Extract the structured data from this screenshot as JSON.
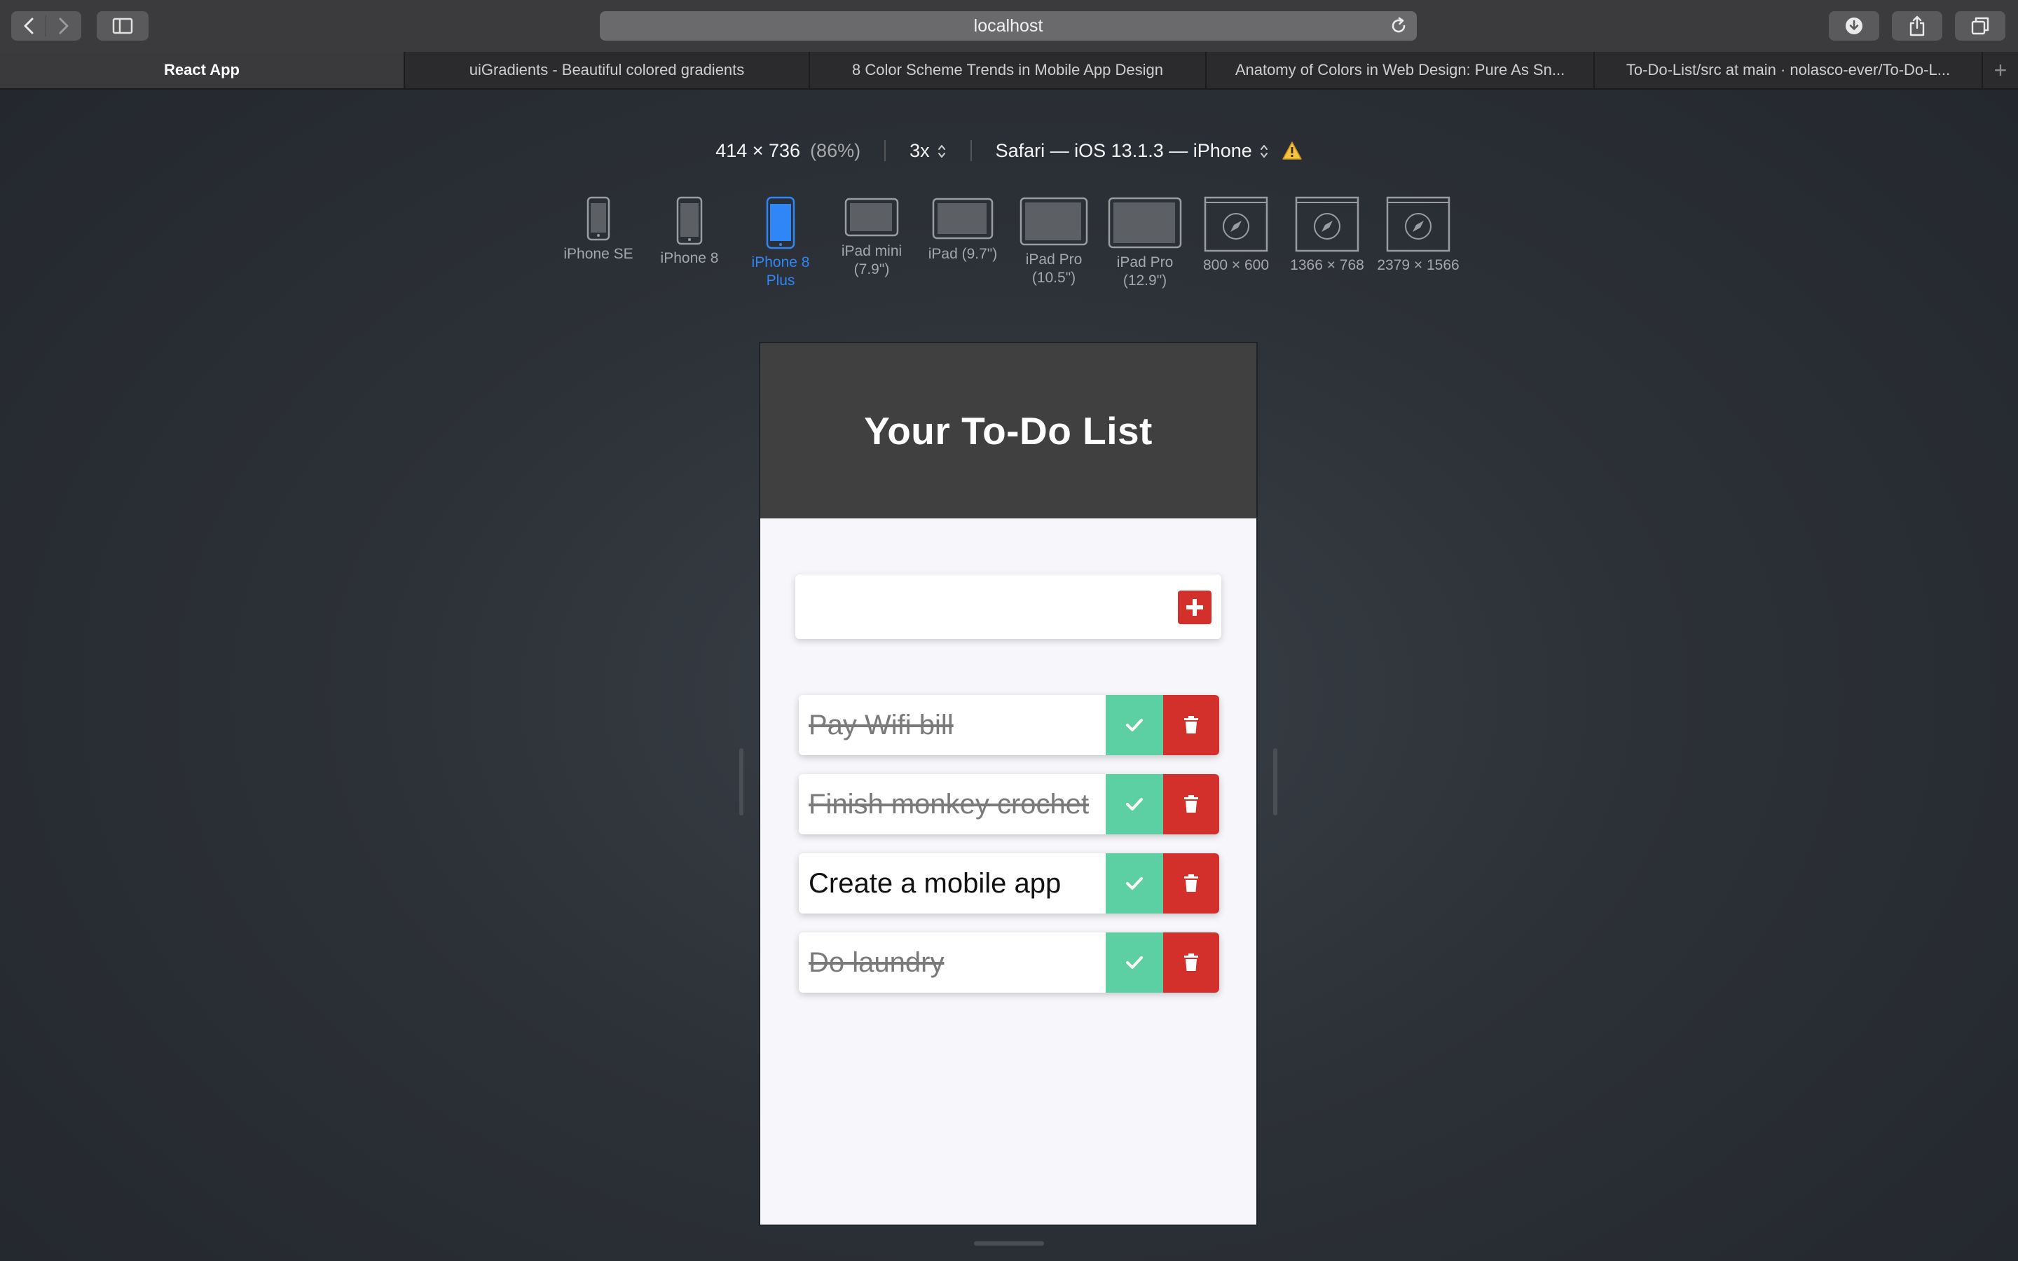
{
  "browser": {
    "address": "localhost",
    "tabs": [
      {
        "label": "React App",
        "active": true
      },
      {
        "label": "uiGradients - Beautiful colored gradients",
        "active": false
      },
      {
        "label": "8 Color Scheme Trends in Mobile App Design",
        "active": false
      },
      {
        "label": "Anatomy of Colors in Web Design: Pure As Sn...",
        "active": false
      },
      {
        "label": "To-Do-List/src at main · nolasco-ever/To-Do-L...",
        "active": false
      }
    ]
  },
  "responsive": {
    "size": "414 × 736",
    "percent": "(86%)",
    "scale": "3x",
    "user_agent": "Safari — iOS 13.1.3 — iPhone",
    "devices": [
      {
        "label": "iPhone SE",
        "selected": false
      },
      {
        "label": "iPhone 8",
        "selected": false
      },
      {
        "label": "iPhone 8 Plus",
        "selected": true
      },
      {
        "label": "iPad mini (7.9\")",
        "selected": false
      },
      {
        "label": "iPad (9.7\")",
        "selected": false
      },
      {
        "label": "iPad Pro (10.5\")",
        "selected": false
      },
      {
        "label": "iPad Pro (12.9\")",
        "selected": false
      },
      {
        "label": "800 × 600",
        "selected": false
      },
      {
        "label": "1366 × 768",
        "selected": false
      },
      {
        "label": "2379 × 1566",
        "selected": false
      }
    ]
  },
  "app": {
    "title": "Your To-Do List",
    "input_value": "",
    "colors": {
      "header": "#404040",
      "complete": "#5cd0a2",
      "delete": "#d3302b"
    },
    "todos": [
      {
        "text": "Pay Wifi bill",
        "completed": true
      },
      {
        "text": "Finish monkey crochet",
        "completed": true
      },
      {
        "text": "Create a mobile app",
        "completed": false
      },
      {
        "text": "Do laundry",
        "completed": true
      }
    ]
  }
}
